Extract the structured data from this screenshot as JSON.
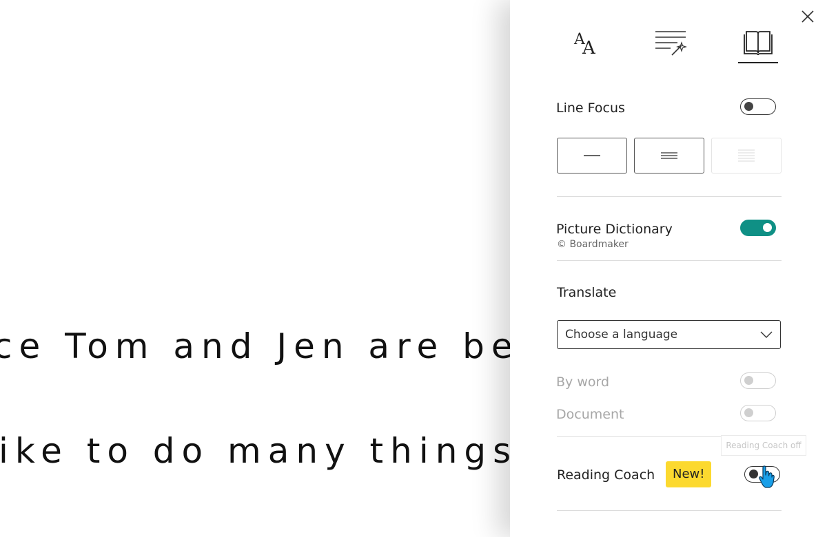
{
  "reader": {
    "line1": "ce Tom and Jen are bes",
    "line2": "ike to do many things"
  },
  "panel": {
    "tabs": [
      {
        "name": "text-preferences",
        "icon": "text-size-icon"
      },
      {
        "name": "grammar-options",
        "icon": "grammar-options-icon"
      },
      {
        "name": "reading-preferences",
        "icon": "book-icon",
        "selected": true
      }
    ],
    "line_focus": {
      "label": "Line Focus",
      "enabled": false,
      "options": [
        "one-line",
        "three-lines",
        "five-lines"
      ]
    },
    "picture_dictionary": {
      "label": "Picture Dictionary",
      "credit": "© Boardmaker",
      "enabled": true
    },
    "translate": {
      "label": "Translate",
      "select_placeholder": "Choose a language",
      "by_word_label": "By word",
      "document_label": "Document"
    },
    "reading_coach": {
      "label": "Reading Coach",
      "badge": "New!",
      "tooltip": "Reading Coach off",
      "enabled": false
    }
  },
  "colors": {
    "toggle_on": "#0f9085",
    "badge": "#fcd92f",
    "cursor": "#1a9fe8"
  }
}
